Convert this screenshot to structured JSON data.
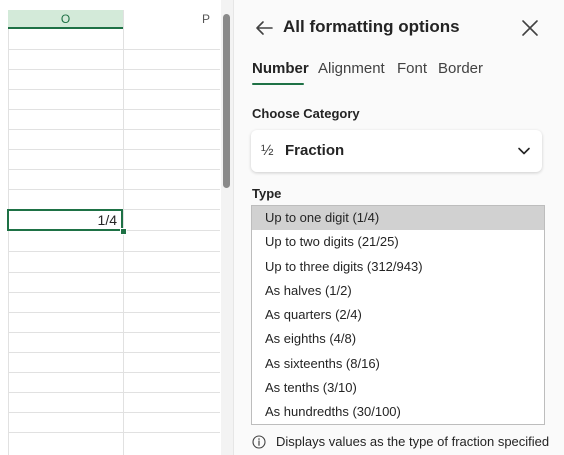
{
  "sheet": {
    "columns": [
      "O",
      "P"
    ],
    "active_cell_value": "1/4"
  },
  "pane": {
    "title": "All formatting options",
    "tabs": [
      {
        "label": "Number",
        "active": true
      },
      {
        "label": "Alignment",
        "active": false
      },
      {
        "label": "Font",
        "active": false
      },
      {
        "label": "Border",
        "active": false
      }
    ],
    "category_label": "Choose Category",
    "category": {
      "icon_glyph": "½",
      "icon": "fraction-icon",
      "value": "Fraction"
    },
    "type_label": "Type",
    "types": [
      {
        "label": "Up to one digit (1/4)",
        "selected": true
      },
      {
        "label": "Up to two digits (21/25)",
        "selected": false
      },
      {
        "label": "Up to three digits (312/943)",
        "selected": false
      },
      {
        "label": "As halves (1/2)",
        "selected": false
      },
      {
        "label": "As quarters (2/4)",
        "selected": false
      },
      {
        "label": "As eighths (4/8)",
        "selected": false
      },
      {
        "label": "As sixteenths (8/16)",
        "selected": false
      },
      {
        "label": "As tenths (3/10)",
        "selected": false
      },
      {
        "label": "As hundredths (30/100)",
        "selected": false
      }
    ],
    "info_text": "Displays values as the type of fraction specified"
  },
  "colors": {
    "accent": "#1e7145",
    "header_highlight": "#d3ead9",
    "selected_item": "#d1d1d1"
  }
}
